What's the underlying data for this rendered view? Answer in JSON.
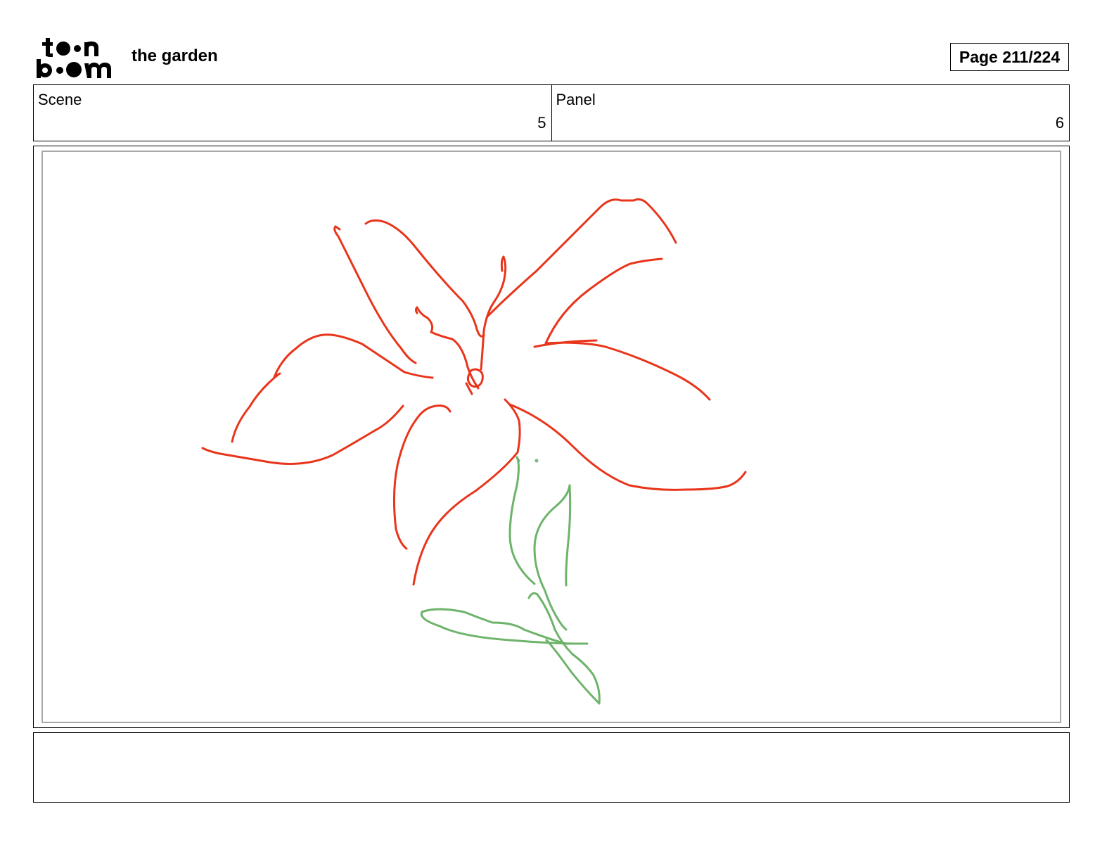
{
  "header": {
    "logo_text": "toon boom",
    "document_title": "the garden",
    "page_indicator": "Page 211/224"
  },
  "info": {
    "scene_label": "Scene",
    "scene_value": "5",
    "panel_label": "Panel",
    "panel_value": "6"
  },
  "panel_image": {
    "subject": "flower-sketch",
    "petal_color": "#e8351b",
    "stem_color": "#6db36a"
  },
  "caption": {
    "text": ""
  }
}
